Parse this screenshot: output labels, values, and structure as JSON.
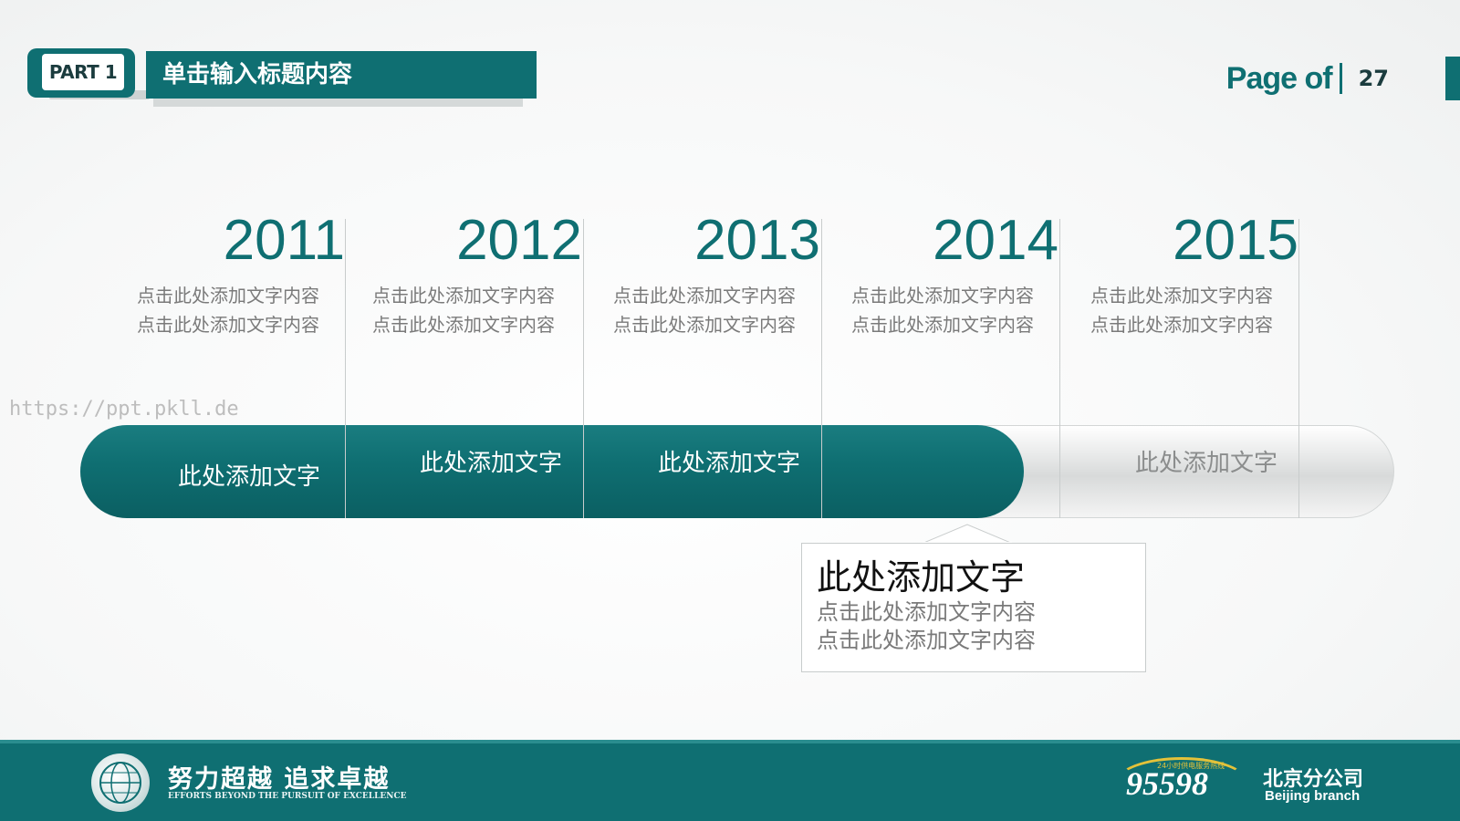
{
  "header": {
    "part_label": "PART 1",
    "title": "单击输入标题内容",
    "page_label": "Page of",
    "page_number": "27"
  },
  "timeline": {
    "years": [
      {
        "year": "2011",
        "desc1": "点击此处添加文字内容",
        "desc2": "点击此处添加文字内容"
      },
      {
        "year": "2012",
        "desc1": "点击此处添加文字内容",
        "desc2": "点击此处添加文字内容"
      },
      {
        "year": "2013",
        "desc1": "点击此处添加文字内容",
        "desc2": "点击此处添加文字内容"
      },
      {
        "year": "2014",
        "desc1": "点击此处添加文字内容",
        "desc2": "点击此处添加文字内容"
      },
      {
        "year": "2015",
        "desc1": "点击此处添加文字内容",
        "desc2": "点击此处添加文字内容"
      }
    ],
    "segment_labels": [
      "此处添加文字",
      "此处添加文字",
      "此处添加文字",
      "此处添加文字"
    ]
  },
  "callout": {
    "title": "此处添加文字",
    "line1": "点击此处添加文字内容",
    "line2": "点击此处添加文字内容"
  },
  "watermark": "https://ppt.pkll.de",
  "footer": {
    "slogan": "努力超越 追求卓越",
    "slogan_en": "EFFORTS BEYOND THE PURSUIT OF EXCELLENCE",
    "hotline": "95598",
    "hotline_caption": "24小时供电服务热线",
    "branch": "北京分公司",
    "branch_en": "Beijing branch"
  },
  "colors": {
    "accent": "#0f6f72",
    "muted_text": "#7a7a7a"
  }
}
